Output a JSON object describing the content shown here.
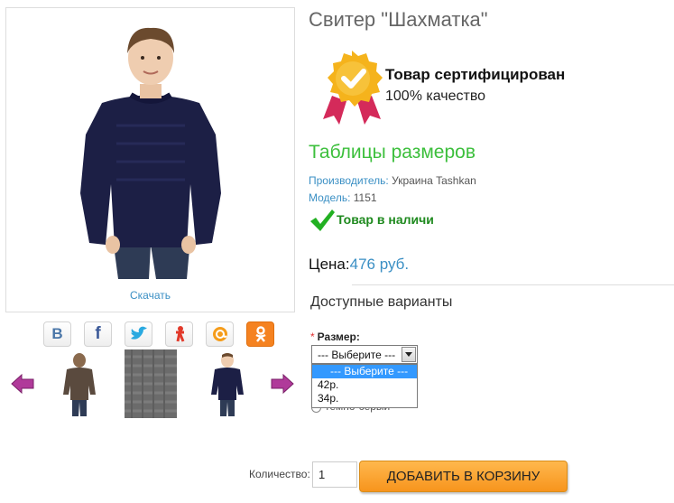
{
  "product": {
    "title": "Свитер \"Шахматка\"",
    "photo_caption": "Скачать"
  },
  "share": {
    "icons": [
      "vk-icon",
      "facebook-icon",
      "twitter-icon",
      "odnoklassniki-figure-icon",
      "mailru-icon",
      "ok-icon"
    ],
    "labels": [
      "В",
      "f"
    ]
  },
  "certificate": {
    "title": "Товар сертифицирован",
    "subtitle": "100% качество"
  },
  "size_tables_link": "Таблицы размеров",
  "meta": {
    "manufacturer_label": "Производитель:",
    "manufacturer_value": "Украина Tashkan",
    "model_label": "Модель:",
    "model_value": "1151"
  },
  "stock": "Товар в наличи",
  "price": {
    "label": "Цена:",
    "value": "476 руб."
  },
  "variants": {
    "heading": "Доступные варианты",
    "size_label": "Размер:",
    "required_mark": "*",
    "selected": "--- Выберите ---",
    "options": [
      "--- Выберите ---",
      "42р.",
      "34р."
    ],
    "hidden_text": "темно-серый"
  },
  "cart": {
    "qty_label": "Количество:",
    "qty_value": "1",
    "add_button": "ДОБАВИТЬ В КОРЗИНУ"
  },
  "colors": {
    "link_blue": "#3a8fc4",
    "green_heading": "#3cbf3c",
    "stock_green": "#1f8a1f",
    "cart_orange": "#f7941d",
    "select_highlight": "#3399ff",
    "sweater_navy": "#1c1f45",
    "sweater_brown": "#5a4a3e",
    "sweater_grey": "#6b6b6b"
  }
}
